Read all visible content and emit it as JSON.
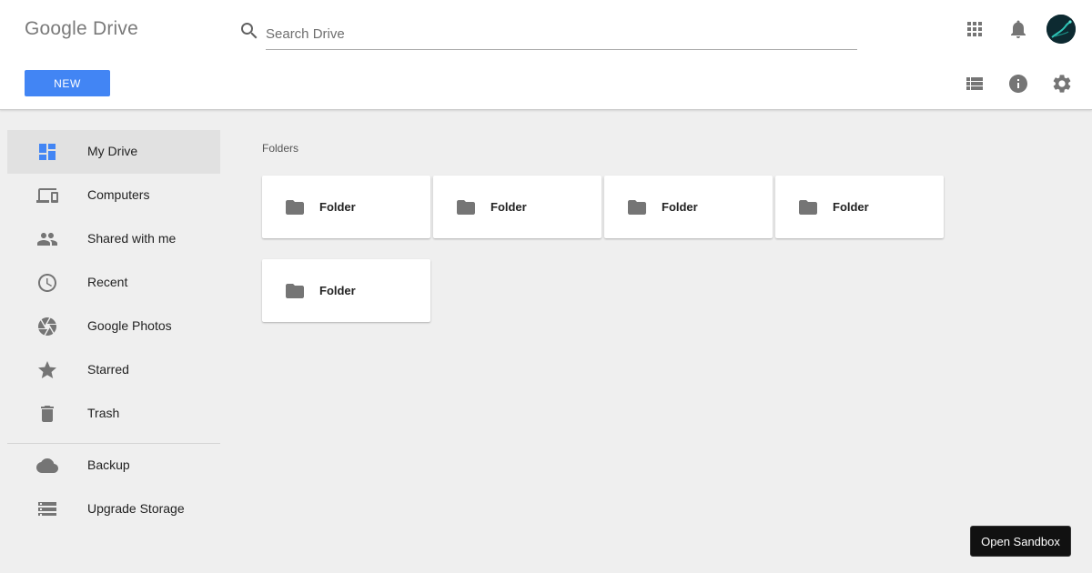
{
  "app": {
    "logo": "Google Drive"
  },
  "search": {
    "placeholder": "Search Drive"
  },
  "header": {
    "icons": [
      "apps-icon",
      "notifications-icon",
      "avatar",
      "list-view-icon",
      "info-icon",
      "settings-icon"
    ]
  },
  "new_button": {
    "label": "NEW"
  },
  "sidebar": {
    "items": [
      {
        "label": "My Drive",
        "icon": "my-drive-icon",
        "active": true
      },
      {
        "label": "Computers",
        "icon": "computers-icon"
      },
      {
        "label": "Shared with me",
        "icon": "shared-icon"
      },
      {
        "label": "Recent",
        "icon": "clock-icon"
      },
      {
        "label": "Google Photos",
        "icon": "photos-icon"
      },
      {
        "label": "Starred",
        "icon": "star-icon"
      },
      {
        "label": "Trash",
        "icon": "trash-icon"
      },
      {
        "label": "Backup",
        "icon": "cloud-icon"
      },
      {
        "label": "Upgrade Storage",
        "icon": "storage-icon"
      }
    ]
  },
  "main": {
    "section_title": "Folders",
    "folders": [
      {
        "label": "Folder"
      },
      {
        "label": "Folder"
      },
      {
        "label": "Folder"
      },
      {
        "label": "Folder"
      },
      {
        "label": "Folder"
      }
    ]
  },
  "sandbox_button": {
    "label": "Open Sandbox"
  },
  "colors": {
    "accent": "#4285f4",
    "icon_gray": "#757575",
    "background": "#efefef"
  }
}
